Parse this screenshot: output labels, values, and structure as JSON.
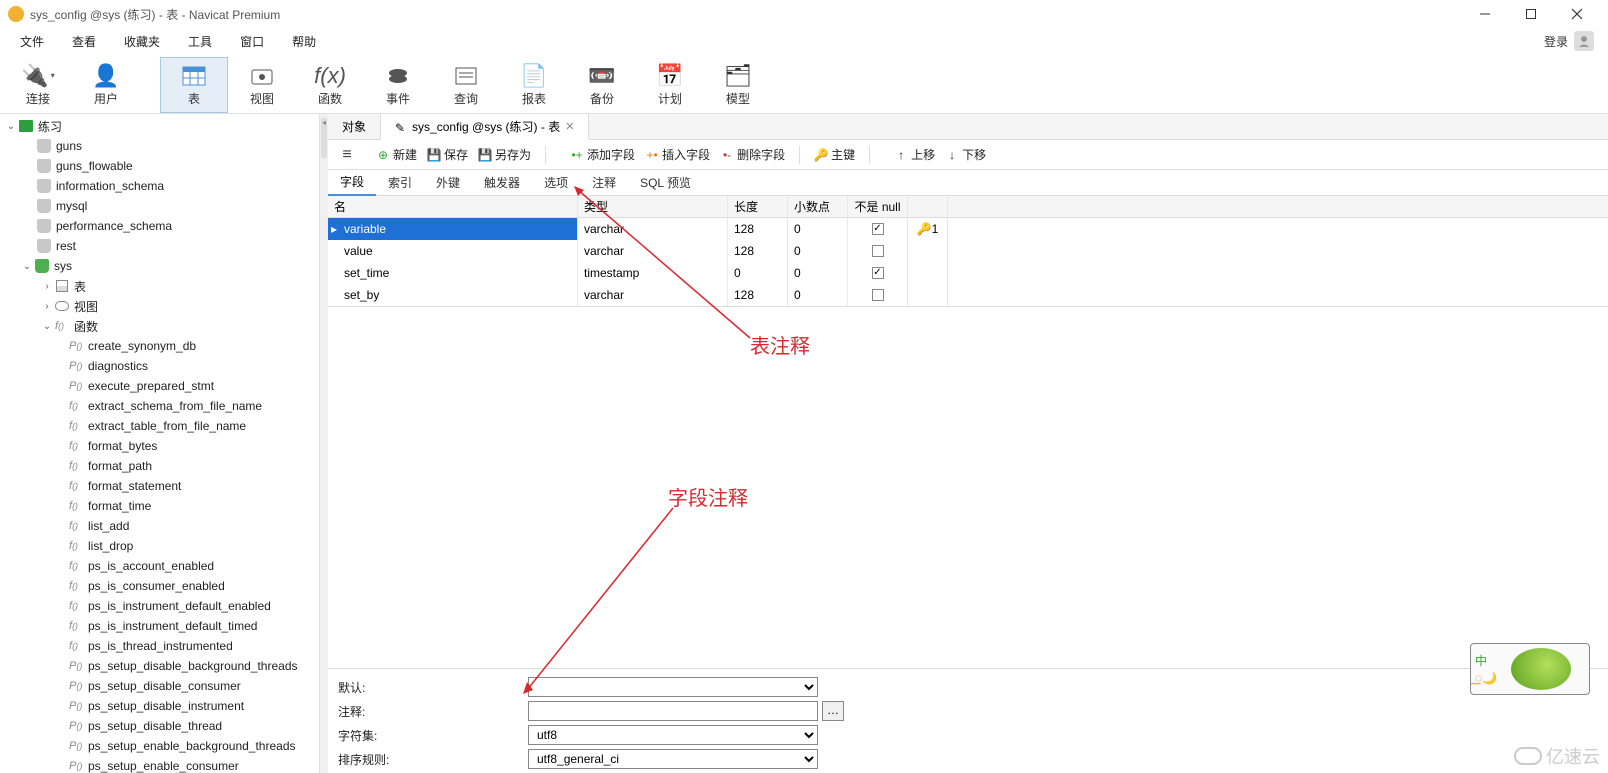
{
  "window": {
    "title": "sys_config @sys (练习) - 表 - Navicat Premium"
  },
  "menus": [
    "文件",
    "查看",
    "收藏夹",
    "工具",
    "窗口",
    "帮助"
  ],
  "login": "登录",
  "toolbar": [
    {
      "label": "连接",
      "icon": "plug"
    },
    {
      "label": "用户",
      "icon": "user"
    },
    {
      "label": "表",
      "icon": "table",
      "active": true
    },
    {
      "label": "视图",
      "icon": "view"
    },
    {
      "label": "函数",
      "icon": "fx"
    },
    {
      "label": "事件",
      "icon": "event"
    },
    {
      "label": "查询",
      "icon": "query"
    },
    {
      "label": "报表",
      "icon": "report"
    },
    {
      "label": "备份",
      "icon": "backup"
    },
    {
      "label": "计划",
      "icon": "schedule"
    },
    {
      "label": "模型",
      "icon": "model"
    }
  ],
  "tree": {
    "conn": "练习",
    "dbs": [
      "guns",
      "guns_flowable",
      "information_schema",
      "mysql",
      "performance_schema",
      "rest"
    ],
    "active_db": "sys",
    "nodes": {
      "table": "表",
      "view": "视图",
      "func": "函数"
    },
    "functions": [
      "create_synonym_db",
      "diagnostics",
      "execute_prepared_stmt",
      "extract_schema_from_file_name",
      "extract_table_from_file_name",
      "format_bytes",
      "format_path",
      "format_statement",
      "format_time",
      "list_add",
      "list_drop",
      "ps_is_account_enabled",
      "ps_is_consumer_enabled",
      "ps_is_instrument_default_enabled",
      "ps_is_instrument_default_timed",
      "ps_is_thread_instrumented",
      "ps_setup_disable_background_threads",
      "ps_setup_disable_consumer",
      "ps_setup_disable_instrument",
      "ps_setup_disable_thread",
      "ps_setup_enable_background_threads",
      "ps_setup_enable_consumer"
    ],
    "fn_kinds": [
      "p",
      "p",
      "p",
      "f",
      "f",
      "f",
      "f",
      "f",
      "f",
      "f",
      "f",
      "f",
      "f",
      "f",
      "f",
      "f",
      "p",
      "p",
      "p",
      "p",
      "p",
      "p"
    ]
  },
  "content_tabs": [
    {
      "label": "对象"
    },
    {
      "label": "sys_config @sys (练习) - 表",
      "active": true
    }
  ],
  "actions": {
    "new": "新建",
    "save": "保存",
    "saveas": "另存为",
    "addfield": "添加字段",
    "insertfield": "插入字段",
    "delfield": "删除字段",
    "pkey": "主键",
    "moveup": "上移",
    "movedown": "下移"
  },
  "sub_tabs": [
    "字段",
    "索引",
    "外键",
    "触发器",
    "选项",
    "注释",
    "SQL 预览"
  ],
  "field_headers": {
    "name": "名",
    "type": "类型",
    "len": "长度",
    "dec": "小数点",
    "null": "不是 null"
  },
  "fields": [
    {
      "name": "variable",
      "type": "varchar",
      "len": "128",
      "dec": "0",
      "null": true,
      "key": "1",
      "selected": true
    },
    {
      "name": "value",
      "type": "varchar",
      "len": "128",
      "dec": "0",
      "null": false
    },
    {
      "name": "set_time",
      "type": "timestamp",
      "len": "0",
      "dec": "0",
      "null": true
    },
    {
      "name": "set_by",
      "type": "varchar",
      "len": "128",
      "dec": "0",
      "null": false
    }
  ],
  "bottom": {
    "default": "默认:",
    "comment": "注释:",
    "charset": "字符集:",
    "collation": "排序规则:",
    "default_val": "",
    "comment_val": "",
    "charset_val": "utf8",
    "collation_val": "utf8_general_ci"
  },
  "anno": {
    "table_comment": "表注释",
    "field_comment": "字段注释"
  },
  "ime": {
    "lang": "中",
    "punct": "꯭"
  },
  "watermark": "亿速云"
}
